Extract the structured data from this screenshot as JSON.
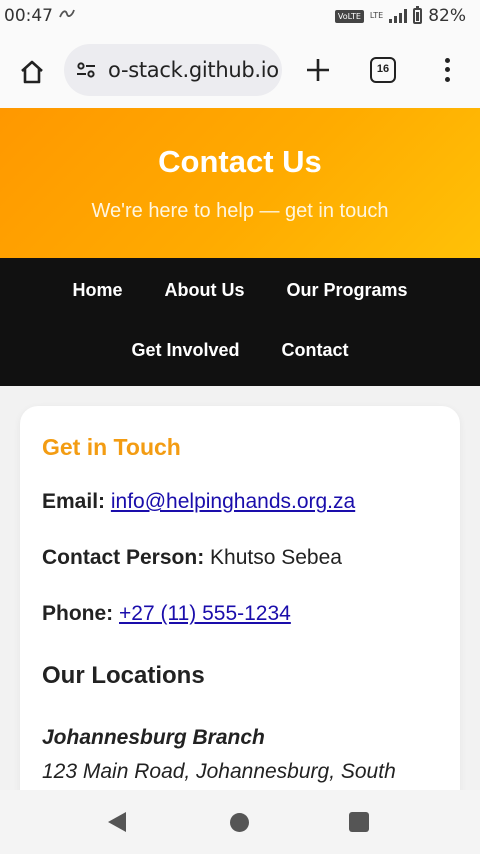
{
  "status_bar": {
    "time": "00:47",
    "misc_icon": "nfc-like-icon",
    "volte": "VoLTE",
    "lte": "LTE",
    "battery": "82%"
  },
  "browser": {
    "url": "o-stack.github.io",
    "tab_count": "16"
  },
  "header": {
    "title": "Contact Us",
    "subtitle": "We're here to help — get in touch"
  },
  "nav": {
    "items": [
      {
        "label": "Home"
      },
      {
        "label": "About Us"
      },
      {
        "label": "Our Programs"
      },
      {
        "label": "Get Involved"
      },
      {
        "label": "Contact"
      }
    ]
  },
  "contact": {
    "heading": "Get in Touch",
    "email_label": "Email:",
    "email_value": "info@helpinghands.org.za",
    "person_label": "Contact Person:",
    "person_value": "Khutso Sebea",
    "phone_label": "Phone:",
    "phone_value": "+27 (11) 555-1234",
    "locations_heading": "Our Locations",
    "branch_name": "Johannesburg Branch",
    "branch_address": "123 Main Road, Johannesburg, South"
  },
  "colors": {
    "accent": "#f39c12",
    "header_start": "#ff9800",
    "header_end": "#ffc107",
    "nav_bg": "#111111",
    "link": "#1a0dab"
  }
}
